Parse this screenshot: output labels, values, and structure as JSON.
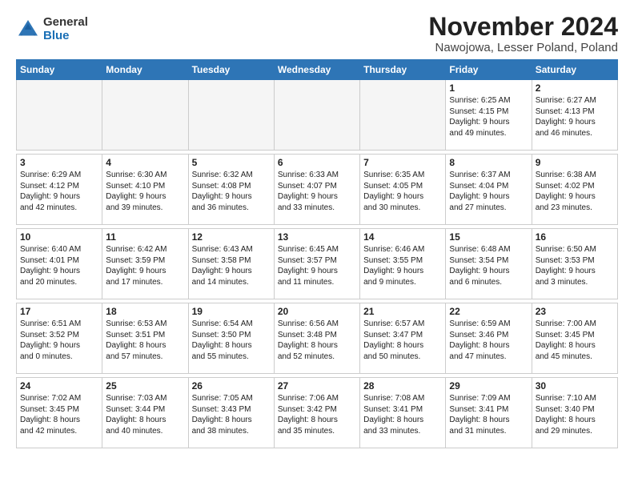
{
  "header": {
    "logo_general": "General",
    "logo_blue": "Blue",
    "month": "November 2024",
    "location": "Nawojowa, Lesser Poland, Poland"
  },
  "weekdays": [
    "Sunday",
    "Monday",
    "Tuesday",
    "Wednesday",
    "Thursday",
    "Friday",
    "Saturday"
  ],
  "weeks": [
    [
      {
        "day": "",
        "info": ""
      },
      {
        "day": "",
        "info": ""
      },
      {
        "day": "",
        "info": ""
      },
      {
        "day": "",
        "info": ""
      },
      {
        "day": "",
        "info": ""
      },
      {
        "day": "1",
        "info": "Sunrise: 6:25 AM\nSunset: 4:15 PM\nDaylight: 9 hours\nand 49 minutes."
      },
      {
        "day": "2",
        "info": "Sunrise: 6:27 AM\nSunset: 4:13 PM\nDaylight: 9 hours\nand 46 minutes."
      }
    ],
    [
      {
        "day": "3",
        "info": "Sunrise: 6:29 AM\nSunset: 4:12 PM\nDaylight: 9 hours\nand 42 minutes."
      },
      {
        "day": "4",
        "info": "Sunrise: 6:30 AM\nSunset: 4:10 PM\nDaylight: 9 hours\nand 39 minutes."
      },
      {
        "day": "5",
        "info": "Sunrise: 6:32 AM\nSunset: 4:08 PM\nDaylight: 9 hours\nand 36 minutes."
      },
      {
        "day": "6",
        "info": "Sunrise: 6:33 AM\nSunset: 4:07 PM\nDaylight: 9 hours\nand 33 minutes."
      },
      {
        "day": "7",
        "info": "Sunrise: 6:35 AM\nSunset: 4:05 PM\nDaylight: 9 hours\nand 30 minutes."
      },
      {
        "day": "8",
        "info": "Sunrise: 6:37 AM\nSunset: 4:04 PM\nDaylight: 9 hours\nand 27 minutes."
      },
      {
        "day": "9",
        "info": "Sunrise: 6:38 AM\nSunset: 4:02 PM\nDaylight: 9 hours\nand 23 minutes."
      }
    ],
    [
      {
        "day": "10",
        "info": "Sunrise: 6:40 AM\nSunset: 4:01 PM\nDaylight: 9 hours\nand 20 minutes."
      },
      {
        "day": "11",
        "info": "Sunrise: 6:42 AM\nSunset: 3:59 PM\nDaylight: 9 hours\nand 17 minutes."
      },
      {
        "day": "12",
        "info": "Sunrise: 6:43 AM\nSunset: 3:58 PM\nDaylight: 9 hours\nand 14 minutes."
      },
      {
        "day": "13",
        "info": "Sunrise: 6:45 AM\nSunset: 3:57 PM\nDaylight: 9 hours\nand 11 minutes."
      },
      {
        "day": "14",
        "info": "Sunrise: 6:46 AM\nSunset: 3:55 PM\nDaylight: 9 hours\nand 9 minutes."
      },
      {
        "day": "15",
        "info": "Sunrise: 6:48 AM\nSunset: 3:54 PM\nDaylight: 9 hours\nand 6 minutes."
      },
      {
        "day": "16",
        "info": "Sunrise: 6:50 AM\nSunset: 3:53 PM\nDaylight: 9 hours\nand 3 minutes."
      }
    ],
    [
      {
        "day": "17",
        "info": "Sunrise: 6:51 AM\nSunset: 3:52 PM\nDaylight: 9 hours\nand 0 minutes."
      },
      {
        "day": "18",
        "info": "Sunrise: 6:53 AM\nSunset: 3:51 PM\nDaylight: 8 hours\nand 57 minutes."
      },
      {
        "day": "19",
        "info": "Sunrise: 6:54 AM\nSunset: 3:50 PM\nDaylight: 8 hours\nand 55 minutes."
      },
      {
        "day": "20",
        "info": "Sunrise: 6:56 AM\nSunset: 3:48 PM\nDaylight: 8 hours\nand 52 minutes."
      },
      {
        "day": "21",
        "info": "Sunrise: 6:57 AM\nSunset: 3:47 PM\nDaylight: 8 hours\nand 50 minutes."
      },
      {
        "day": "22",
        "info": "Sunrise: 6:59 AM\nSunset: 3:46 PM\nDaylight: 8 hours\nand 47 minutes."
      },
      {
        "day": "23",
        "info": "Sunrise: 7:00 AM\nSunset: 3:45 PM\nDaylight: 8 hours\nand 45 minutes."
      }
    ],
    [
      {
        "day": "24",
        "info": "Sunrise: 7:02 AM\nSunset: 3:45 PM\nDaylight: 8 hours\nand 42 minutes."
      },
      {
        "day": "25",
        "info": "Sunrise: 7:03 AM\nSunset: 3:44 PM\nDaylight: 8 hours\nand 40 minutes."
      },
      {
        "day": "26",
        "info": "Sunrise: 7:05 AM\nSunset: 3:43 PM\nDaylight: 8 hours\nand 38 minutes."
      },
      {
        "day": "27",
        "info": "Sunrise: 7:06 AM\nSunset: 3:42 PM\nDaylight: 8 hours\nand 35 minutes."
      },
      {
        "day": "28",
        "info": "Sunrise: 7:08 AM\nSunset: 3:41 PM\nDaylight: 8 hours\nand 33 minutes."
      },
      {
        "day": "29",
        "info": "Sunrise: 7:09 AM\nSunset: 3:41 PM\nDaylight: 8 hours\nand 31 minutes."
      },
      {
        "day": "30",
        "info": "Sunrise: 7:10 AM\nSunset: 3:40 PM\nDaylight: 8 hours\nand 29 minutes."
      }
    ]
  ]
}
